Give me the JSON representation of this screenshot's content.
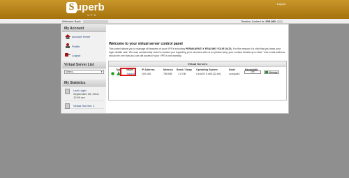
{
  "header": {
    "logo_word": "uperb",
    "logo_letter": "S",
    "logo_sub": "VPS",
    "logout": "Logout"
  },
  "userbar": {
    "welcome": "Welcome Back",
    "session_prefix": "Session Locked to:",
    "session_ip": "209.160."
  },
  "sidebar": {
    "my_account": "My Account",
    "account_home": "Account Home",
    "profile": "Profile",
    "logout": "Logout",
    "vs_list": "Virtual Server List",
    "select_value": "Select...",
    "my_stats": "My Statistics",
    "last_login_label": "Last Login:",
    "last_login_value": "September 25, 2010, 12:50 am",
    "virtual_servers": "Virtual Servers: 1"
  },
  "main": {
    "title": "Welcome to your virtual server control panel",
    "desc_1": "This panel allows you to manage all features of your VPS's including ",
    "desc_bold": "PERMANENTLY ERASING YOUR DATA.",
    "desc_2": " For this reason it is vital that you keep your login details safe. We may occasionally need to contact you regarding your services with us so please keep your contact details up to date. Your email address should be one that you can still access if your VPS is not working",
    "vs_title": "Virtual Servers",
    "columns": [
      "Type",
      "Name",
      "IP Address",
      "Memory",
      "Burst / Swap",
      "Operating System",
      "Node",
      "Bandwidth"
    ],
    "row": {
      "name": "Tracker",
      "ip": "209.160.",
      "memory": "768 MB",
      "burst": "1.0 GB",
      "os": "CentOS 5 x86 (32-bit)",
      "node": "compute1",
      "bandwidth": "0%",
      "manage": "Manage"
    }
  },
  "colors": {
    "header": "#b3801a",
    "highlight": "#e01010"
  }
}
